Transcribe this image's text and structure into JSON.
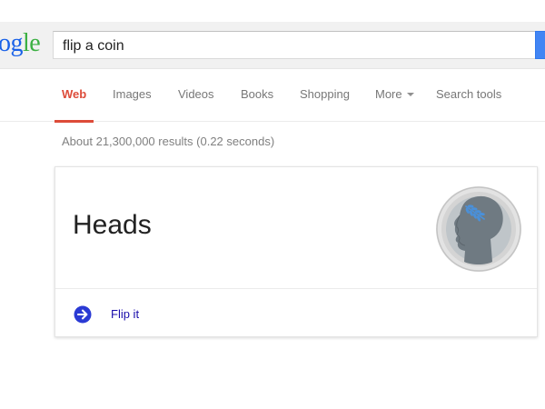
{
  "header": {
    "logo_parts": [
      "o",
      "g",
      "le"
    ],
    "search": {
      "value": "flip a coin",
      "placeholder": ""
    }
  },
  "tabs": [
    {
      "label": "Web",
      "active": true
    },
    {
      "label": "Images",
      "active": false
    },
    {
      "label": "Videos",
      "active": false
    },
    {
      "label": "Books",
      "active": false
    },
    {
      "label": "Shopping",
      "active": false
    },
    {
      "label": "More",
      "active": false
    },
    {
      "label": "Search tools",
      "active": false
    }
  ],
  "result_stats": "About 21,300,000 results (0.22 seconds)",
  "coin_card": {
    "result": "Heads",
    "coin_icon": "coin-heads-icon",
    "flip_icon": "arrow-right-circle-icon",
    "flip_label": "Flip it"
  },
  "colors": {
    "accent_red": "#dd4b39",
    "link_blue": "#1a0dab",
    "arrow_blue": "#2a3ad4",
    "search_blue": "#4285f4"
  }
}
